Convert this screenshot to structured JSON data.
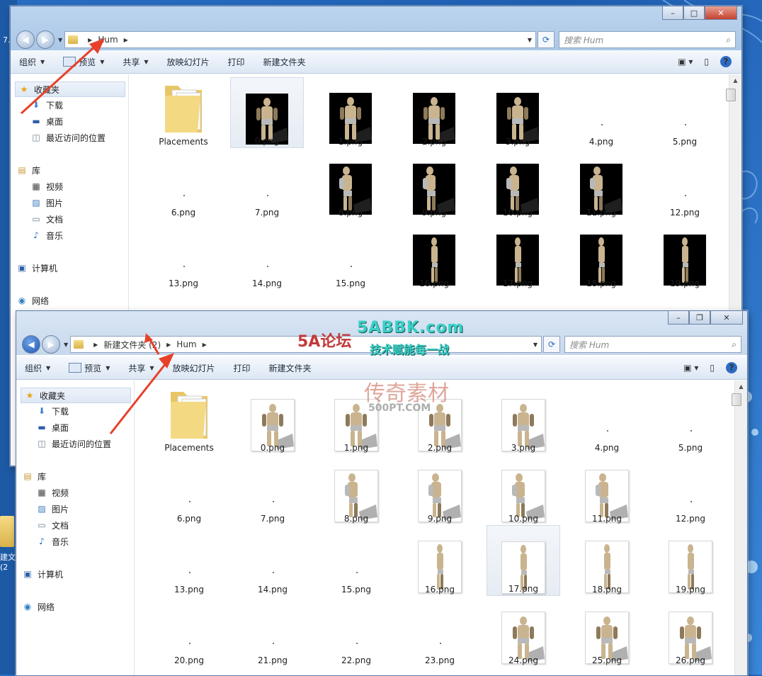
{
  "windows": [
    {
      "id": "top",
      "breadcrumb": [
        "Hum"
      ],
      "search_placeholder": "搜索 Hum",
      "toolbar": [
        "组织",
        "预览",
        "共享",
        "放映幻灯片",
        "打印",
        "新建文件夹"
      ],
      "toolbar_dropdown": [
        true,
        true,
        true,
        false,
        false,
        false
      ],
      "nav": {
        "favorites": "收藏夹",
        "favorites_items": [
          "下载",
          "桌面",
          "最近访问的位置"
        ],
        "libraries": "库",
        "library_items": [
          "视频",
          "图片",
          "文档",
          "音乐"
        ],
        "computer": "计算机",
        "network": "网络"
      },
      "files": [
        {
          "name": "Placements",
          "kind": "folder"
        },
        {
          "name": "0.png",
          "kind": "black",
          "pose": "front",
          "selected": true
        },
        {
          "name": "1.png",
          "kind": "black",
          "pose": "front"
        },
        {
          "name": "2.png",
          "kind": "black",
          "pose": "front"
        },
        {
          "name": "3.png",
          "kind": "black",
          "pose": "front"
        },
        {
          "name": "4.png",
          "kind": "blank"
        },
        {
          "name": "5.png",
          "kind": "blank"
        },
        {
          "name": "6.png",
          "kind": "blank"
        },
        {
          "name": "7.png",
          "kind": "blank"
        },
        {
          "name": "8.png",
          "kind": "black",
          "pose": "turn"
        },
        {
          "name": "9.png",
          "kind": "black",
          "pose": "turn"
        },
        {
          "name": "10.png",
          "kind": "black",
          "pose": "turn"
        },
        {
          "name": "11.png",
          "kind": "black",
          "pose": "turn"
        },
        {
          "name": "12.png",
          "kind": "blank"
        },
        {
          "name": "13.png",
          "kind": "blank"
        },
        {
          "name": "14.png",
          "kind": "blank"
        },
        {
          "name": "15.png",
          "kind": "blank"
        },
        {
          "name": "16.png",
          "kind": "black",
          "pose": "side"
        },
        {
          "name": "17.png",
          "kind": "black",
          "pose": "side"
        },
        {
          "name": "18.png",
          "kind": "black",
          "pose": "side"
        },
        {
          "name": "19.png",
          "kind": "black",
          "pose": "side"
        }
      ]
    },
    {
      "id": "bottom",
      "breadcrumb": [
        "新建文件夹 (2)",
        "Hum"
      ],
      "search_placeholder": "搜索 Hum",
      "toolbar": [
        "组织",
        "预览",
        "共享",
        "放映幻灯片",
        "打印",
        "新建文件夹"
      ],
      "toolbar_dropdown": [
        true,
        true,
        true,
        false,
        false,
        false
      ],
      "nav": {
        "favorites": "收藏夹",
        "favorites_items": [
          "下载",
          "桌面",
          "最近访问的位置"
        ],
        "libraries": "库",
        "library_items": [
          "视频",
          "图片",
          "文档",
          "音乐"
        ],
        "computer": "计算机",
        "network": "网络"
      },
      "files": [
        {
          "name": "Placements",
          "kind": "folder"
        },
        {
          "name": "0.png",
          "kind": "white",
          "pose": "front"
        },
        {
          "name": "1.png",
          "kind": "white",
          "pose": "front"
        },
        {
          "name": "2.png",
          "kind": "white",
          "pose": "front"
        },
        {
          "name": "3.png",
          "kind": "white",
          "pose": "front"
        },
        {
          "name": "4.png",
          "kind": "blank"
        },
        {
          "name": "5.png",
          "kind": "blank"
        },
        {
          "name": "6.png",
          "kind": "blank"
        },
        {
          "name": "7.png",
          "kind": "blank"
        },
        {
          "name": "8.png",
          "kind": "white",
          "pose": "turn"
        },
        {
          "name": "9.png",
          "kind": "white",
          "pose": "turn"
        },
        {
          "name": "10.png",
          "kind": "white",
          "pose": "turn"
        },
        {
          "name": "11.png",
          "kind": "white",
          "pose": "turn"
        },
        {
          "name": "12.png",
          "kind": "blank"
        },
        {
          "name": "13.png",
          "kind": "blank"
        },
        {
          "name": "14.png",
          "kind": "blank"
        },
        {
          "name": "15.png",
          "kind": "blank"
        },
        {
          "name": "16.png",
          "kind": "white",
          "pose": "side"
        },
        {
          "name": "17.png",
          "kind": "white",
          "pose": "side",
          "selected": true
        },
        {
          "name": "18.png",
          "kind": "white",
          "pose": "side"
        },
        {
          "name": "19.png",
          "kind": "white",
          "pose": "side"
        },
        {
          "name": "20.png",
          "kind": "blank"
        },
        {
          "name": "21.png",
          "kind": "blank"
        },
        {
          "name": "22.png",
          "kind": "blank"
        },
        {
          "name": "23.png",
          "kind": "blank"
        },
        {
          "name": "24.png",
          "kind": "white",
          "pose": "front"
        },
        {
          "name": "25.png",
          "kind": "white",
          "pose": "front"
        },
        {
          "name": "26.png",
          "kind": "white",
          "pose": "front"
        }
      ]
    }
  ],
  "desktop": {
    "icon_label": "建文",
    "icon_sub": "(2",
    "edge_number": "7."
  },
  "watermark": {
    "site": "5ABBK.com",
    "slogan": "技术赋能每一战",
    "forum": "5A论坛",
    "brand": "传奇素材",
    "domain": "500PT.COM"
  },
  "colors": {
    "desktop": "#2a6fc4",
    "arrow": "#e8402a",
    "selection": "#e6ecf3"
  }
}
